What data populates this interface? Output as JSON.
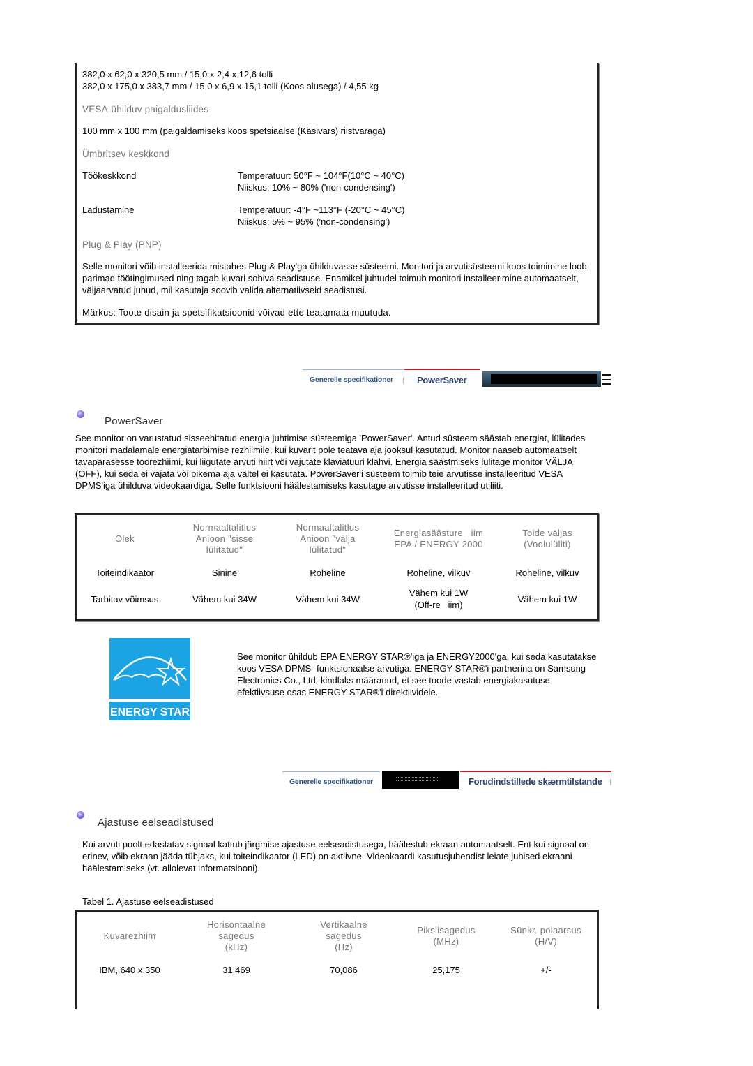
{
  "specs": {
    "dimensions_line1": "382,0 x 62,0 x 320,5 mm / 15,0 x 2,4 x 12,6 tolli",
    "dimensions_line2": "382,0 x 175,0 x 383,7 mm / 15,0 x 6,9 x 15,1 tolli (Koos alusega) / 4,55 kg",
    "vesa_heading": "VESA-ühilduv paigaldusliides",
    "vesa_value": "100 mm x 100 mm (paigaldamiseks koos spetsiaalse (Käsivars) riistvaraga)",
    "environment_heading": "Ümbritsev keskkond",
    "environment": [
      {
        "label": "Töökeskkond",
        "line1": "Temperatuur: 50°F ~ 104°F(10°C ~ 40°C)",
        "line2": "Niiskus: 10% ~ 80% ('non-condensing')"
      },
      {
        "label": "Ladustamine",
        "line1": "Temperatuur: -4°F ~113°F (-20°C ~ 45°C)",
        "line2": "Niiskus: 5% ~ 95% ('non-condensing')"
      }
    ],
    "pnp_heading": "Plug & Play (PNP)",
    "pnp_text": "Selle monitori võib installeerida mistahes Plug & Play'ga ühilduvasse süsteemi. Monitori ja arvutisüsteemi koos toimimine loob parimad töötingimused ning tagab kuvari sobiva seadistuse. Enamikel juhtudel toimub monitori installeerimine automaatselt, väljaarvatud juhud, mil kasutaja soovib valida alternatiivseid seadistusi.",
    "note": "Märkus: Toote disain ja spetsifikatsioonid võivad ette teatamata muutuda."
  },
  "nav1": {
    "tab_general": "Generelle specifikationer",
    "tab_active": "PowerSaver",
    "accent_color": "#b3202a"
  },
  "powersaver": {
    "title": "PowerSaver",
    "text": "See monitor on varustatud sisseehitatud energia juhtimise süsteemiga 'PowerSaver'. Antud süsteem säästab energiat, lülitades monitori madalamale energiatarbimise rezhiimile, kui kuvarit pole teatava aja jooksul kasutatud. Monitor naaseb automaatselt tavapärasesse töörezhiimi, kui liigutate arvuti hiirt või vajutate klaviatuuri klahvi. Energia säästmiseks lülitage monitor VÄLJA (OFF), kui seda ei vajata või pikema aja vältel ei kasutata. PowerSaver'i süsteem toimib teie arvutisse installeeritud VESA DPMS'iga ühilduva videokaardiga. Selle funktsiooni häälestamiseks kasutage arvutisse installeeritud utiliiti.",
    "table": {
      "headers": [
        [
          "Olek"
        ],
        [
          "Normaaltalitlus",
          "Anioon \"sisse",
          "lülitatud\""
        ],
        [
          "Normaaltalitlus",
          "Anioon \"välja",
          "lülitatud\""
        ],
        [
          "Energiasäästure   iim",
          "EPA / ENERGY 2000"
        ],
        [
          "Toide väljas",
          "(Voolulüliti)"
        ]
      ],
      "rows": [
        {
          "cells": [
            [
              "Toiteindikaator"
            ],
            [
              "Sinine"
            ],
            [
              "Roheline"
            ],
            [
              "Roheline, vilkuv"
            ],
            [
              "Roheline, vilkuv"
            ]
          ]
        },
        {
          "cells": [
            [
              "Tarbitav võimsus"
            ],
            [
              "Vähem kui 34W"
            ],
            [
              "Vähem kui 34W"
            ],
            [
              "Vähem kui 1W",
              "(Off-re   iim)"
            ],
            [
              "Vähem kui 1W"
            ]
          ]
        }
      ]
    }
  },
  "energy_star": {
    "logo_script": "energy",
    "logo_label": "ENERGY STAR",
    "logo_color": "#1ba3e3",
    "text": "See monitor ühildub EPA ENERGY STAR®'iga ja ENERGY2000'ga, kui seda kasutatakse koos VESA DPMS -funktsionaalse arvutiga. ENERGY STAR®'i partnerina on Samsung Electronics Co., Ltd. kindlaks määranud, et see toode vastab energiakasutuse efektiivsuse osas ENERGY STAR®'i direktiividele."
  },
  "nav2": {
    "tab_general": "Generelle specifikationer",
    "tab_active": "Forudindstillede skærmtilstande"
  },
  "timing": {
    "title": "Ajastuse eelseadistused",
    "text": "Kui arvuti poolt edastatav signaal kattub järgmise ajastuse eelseadistusega, häälestub ekraan automaatselt. Ent kui signaal on erinev, võib ekraan jääda tühjaks, kui toiteindikaator (LED) on aktiivne. Videokaardi kasutusjuhendist leiate juhised ekraani häälestamiseks (vt. allolevat informatsiooni).",
    "table_caption": "Tabel 1. Ajastuse eelseadistused",
    "table": {
      "headers": [
        [
          "Kuvarezhiim"
        ],
        [
          "Horisontaalne",
          "sagedus",
          "(kHz)"
        ],
        [
          "Vertikaalne",
          "sagedus",
          "(Hz)"
        ],
        [
          "Pikslisagedus",
          "(MHz)"
        ],
        [
          "Sünkr. polaarsus",
          "(H/V)"
        ]
      ],
      "rows": [
        {
          "cells": [
            "IBM, 640 x 350",
            "31,469",
            "70,086",
            "25,175",
            "+/-"
          ]
        }
      ]
    }
  }
}
